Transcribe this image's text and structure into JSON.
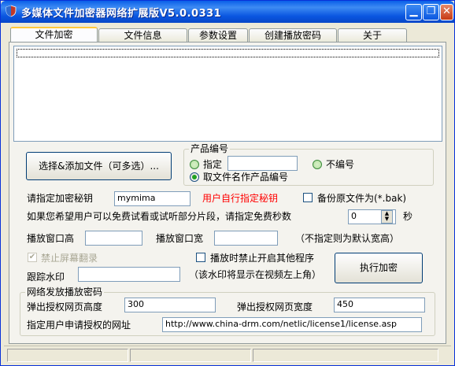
{
  "window": {
    "title": "多媒体文件加密器网络扩展版V5.0.0331"
  },
  "titlebar_buttons": {
    "minimize": "▁",
    "restore": "❐",
    "close": "✕"
  },
  "tabs": [
    {
      "label": "文件加密",
      "active": true
    },
    {
      "label": "文件信息",
      "active": false
    },
    {
      "label": "参数设置",
      "active": false
    },
    {
      "label": "创建播放密码",
      "active": false
    },
    {
      "label": "关于",
      "active": false
    }
  ],
  "main": {
    "add_files_button": "选择&添加文件（可多选）...",
    "product_group": {
      "label": "产品编号",
      "specify_label": "指定",
      "specify_value": "",
      "no_number_label": "不编号",
      "use_filename_label": "取文件名作产品编号"
    },
    "key_label": "请指定加密秘钥",
    "key_value": "mymima",
    "key_hint": "用户自行指定秘钥",
    "backup_label": "备份原文件为(*.bak)",
    "trial_label": "如果您希望用户可以免费试看或试听部分片段，请指定免费秒数",
    "trial_seconds": "0",
    "trial_unit": "秒",
    "window_height_label": "播放窗口高",
    "window_height_value": "",
    "window_width_label": "播放窗口宽",
    "window_width_value": "",
    "window_size_hint": "（不指定则为默认宽高）",
    "disable_screen_record_label": "禁止屏幕翻录",
    "disable_other_programs_label": "播放时禁止开启其他程序",
    "watermark_label": "跟踪水印",
    "watermark_value": "",
    "watermark_hint": "（该水印将显示在视频左上角）",
    "execute_button": "执行加密"
  },
  "network_group": {
    "label": "网络发放播放密码",
    "popup_height_label": "弹出授权网页高度",
    "popup_height_value": "300",
    "popup_width_label": "弹出授权网页宽度",
    "popup_width_value": "450",
    "url_label": "指定用户申请授权的网址",
    "url_value": "http://www.china-drm.com/netlic/license1/license.asp"
  },
  "colors": {
    "accent": "#0054e3",
    "hint_red": "#ff0000",
    "radio_green": "#21a121"
  },
  "icons": {
    "app": "app-shield-icon"
  }
}
